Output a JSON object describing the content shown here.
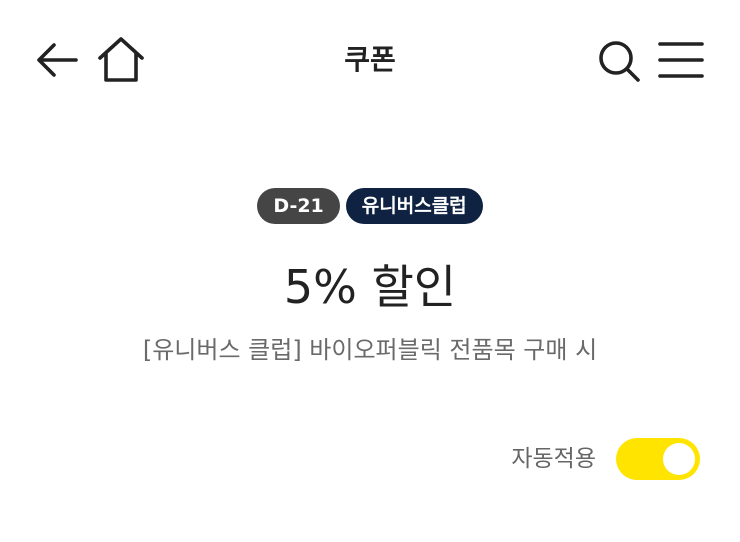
{
  "header": {
    "title": "쿠폰",
    "icons": {
      "back": "back-arrow-icon",
      "home": "home-icon",
      "search": "search-icon",
      "menu": "hamburger-menu-icon"
    }
  },
  "coupon": {
    "dday_badge": "D-21",
    "club_badge": "유니버스클럽",
    "discount": "5% 할인",
    "description": "[유니버스 클럽] 바이오퍼블릭 전품목 구매 시"
  },
  "auto_apply": {
    "label": "자동적용",
    "enabled": true,
    "toggle_color": "#ffe400"
  },
  "colors": {
    "dday_badge_bg": "#454545",
    "club_badge_bg": "#0f2242"
  }
}
